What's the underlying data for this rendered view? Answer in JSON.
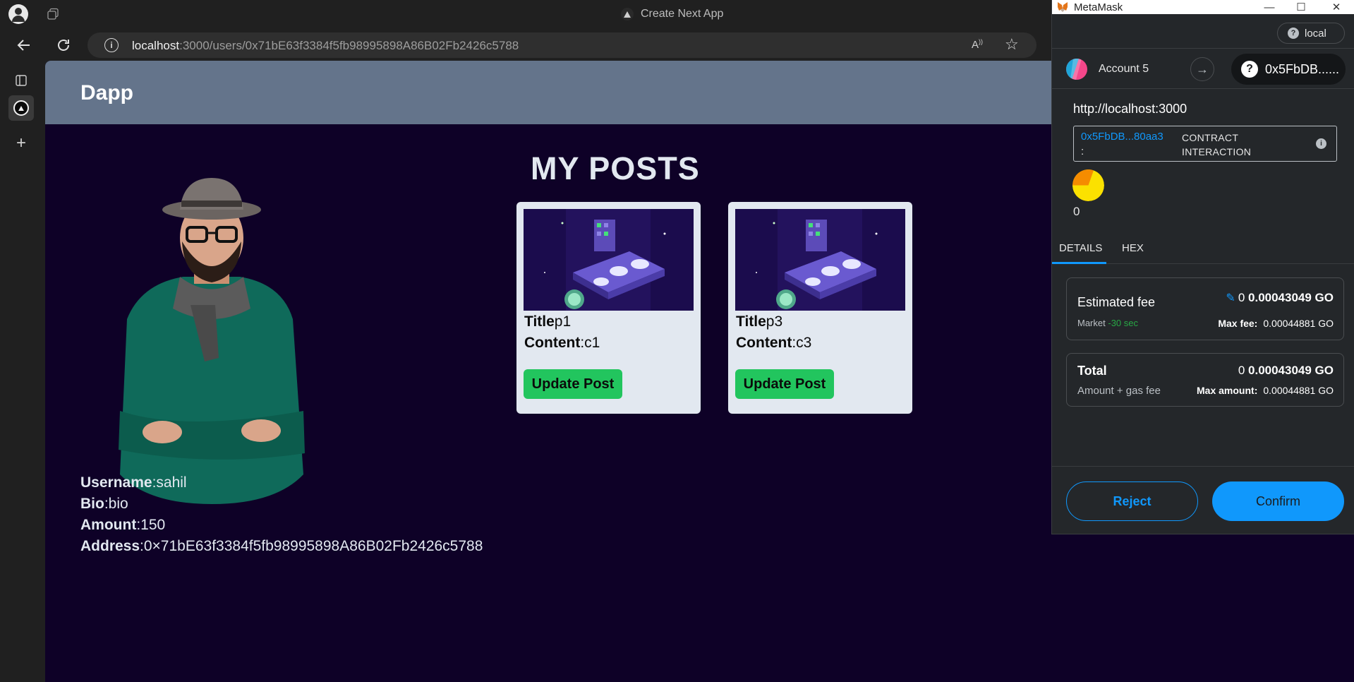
{
  "browser": {
    "tab_title": "Create Next App",
    "url_host": "localhost",
    "url_rest": ":3000/users/0x71bE63f3384f5fb98995898A86B02Fb2426c5788"
  },
  "site": {
    "brand": "Dapp",
    "posts_heading": "MY POSTS",
    "posts": [
      {
        "title_label": "Title",
        "title_value": "p1",
        "content_label": "Content",
        "content_value": ":c1",
        "button": "Update Post"
      },
      {
        "title_label": "Title",
        "title_value": "p3",
        "content_label": "Content",
        "content_value": ":c3",
        "button": "Update Post"
      }
    ],
    "profile": {
      "username_label": "Username",
      "username_value": ":sahil",
      "bio_label": "Bio",
      "bio_value": ":bio",
      "amount_label": "Amount",
      "amount_value": ":150",
      "address_label": "Address",
      "address_value": ":0×71bE63f3384f5fb98995898A86B02Fb2426c5788"
    }
  },
  "metamask": {
    "app_title": "MetaMask",
    "network": "local",
    "account_name": "Account 5",
    "recipient_short": "0x5FbDB......",
    "origin": "http://localhost:3000",
    "contract_addr": "0x5FbDB...80aa3",
    "contract_colon": ":",
    "contract_type": "CONTRACT INTERACTION",
    "token_amount": "0",
    "tabs": {
      "details": "DETAILS",
      "hex": "HEX"
    },
    "estimated_fee": {
      "label": "Estimated fee",
      "market": "Market",
      "time": "-30 sec",
      "zero": "0",
      "amount": "0.00043049 GO",
      "max_label": "Max fee:",
      "max_value": "0.00044881 GO"
    },
    "total": {
      "label": "Total",
      "sub": "Amount + gas fee",
      "zero": "0",
      "amount": "0.00043049 GO",
      "max_label": "Max amount:",
      "max_value": "0.00044881 GO"
    },
    "reject": "Reject",
    "confirm": "Confirm",
    "colors": {
      "accent": "#1098fc",
      "panel": "#24272a",
      "success": "#28a745"
    }
  }
}
